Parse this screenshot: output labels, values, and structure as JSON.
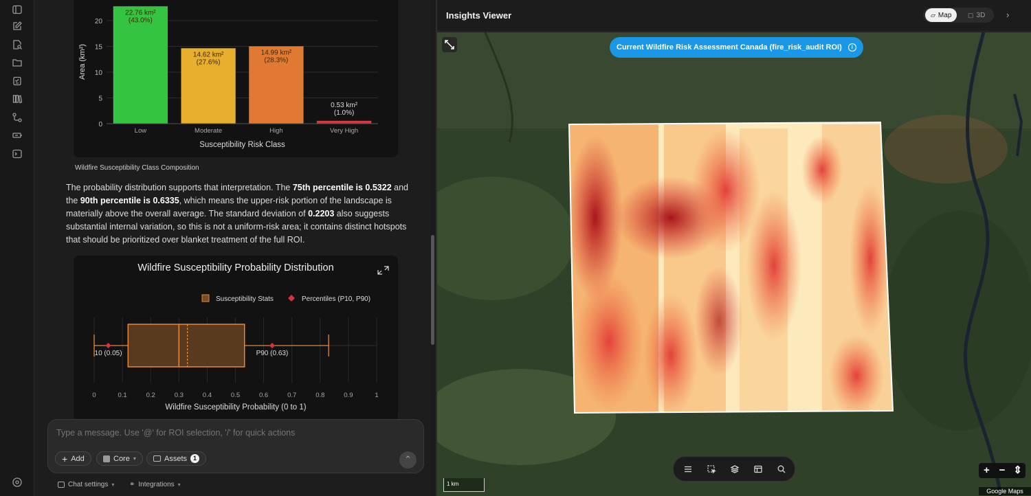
{
  "rail": {
    "icons": [
      "sidebar-toggle-icon",
      "compose-icon",
      "search-doc-icon",
      "folder-icon",
      "checklist-icon",
      "library-icon",
      "workflow-icon",
      "battery-icon",
      "terminal-icon",
      "settings-icon"
    ]
  },
  "bar_chart": {
    "caption": "Wildfire Susceptibility Class Composition",
    "chart_data": {
      "type": "bar",
      "categories": [
        "Low",
        "Moderate",
        "High",
        "Very High"
      ],
      "values": [
        22.76,
        14.62,
        14.99,
        0.53
      ],
      "data_labels": [
        "22.76 km²",
        "14.62 km²",
        "14.99 km²",
        "0.53 km²"
      ],
      "percent_labels": [
        "(43.0%)",
        "(27.6%)",
        "(28.3%)",
        "(1.0%)"
      ],
      "colors": [
        "#35c43f",
        "#e8ae2e",
        "#e07a32",
        "#d9343b"
      ],
      "xlabel": "Susceptibility Risk Class",
      "ylabel": "Area (km²)",
      "yticks": [
        "0",
        "5",
        "10",
        "15",
        "20"
      ],
      "ylim": [
        0,
        24
      ]
    }
  },
  "paragraph": {
    "t1": "The probability distribution supports that interpretation. The ",
    "b1": "75th percentile is 0.5322",
    "t2": " and the ",
    "b2": "90th percentile is 0.6335",
    "t3": ", which means the upper-risk portion of the landscape is materially above the overall average. The standard deviation of ",
    "b3": "0.2203",
    "t4": " also suggests substantial internal variation, so this is not a uniform-risk area; it contains distinct hotspots that should be prioritized over blanket treatment of the full ROI."
  },
  "box_chart": {
    "chart_data": {
      "type": "box",
      "title": "Wildfire Susceptibility Probability Distribution",
      "legend": [
        "Susceptibility Stats",
        "Percentiles (P10, P90)"
      ],
      "min": 0.0,
      "q1": 0.12,
      "median": 0.3,
      "mean": 0.33,
      "q3": 0.5322,
      "max": 0.83,
      "p10": 0.05,
      "p90": 0.63,
      "p10_label": "10 (0.05)",
      "p90_label": "P90 (0.63)",
      "xlabel": "Wildfire Susceptibility Probability (0 to 1)",
      "xticks": [
        "0",
        "0.1",
        "0.2",
        "0.3",
        "0.4",
        "0.5",
        "0.6",
        "0.7",
        "0.8",
        "0.9",
        "1"
      ],
      "xlim": [
        0,
        1
      ]
    }
  },
  "composer": {
    "placeholder": "Type a message. Use '@' for ROI selection, '/' for quick actions",
    "add_label": "Add",
    "core_label": "Core",
    "assets_label": "Assets",
    "assets_count": "1"
  },
  "footer": {
    "chat_settings": "Chat settings",
    "integrations": "Integrations"
  },
  "viewer": {
    "title": "Insights Viewer",
    "map_label": "Map",
    "three_d_label": "3D",
    "roi_label": "Current Wildfire Risk Assessment Canada (fire_risk_audit ROI)",
    "scale": "1 km",
    "zoom_in": "+",
    "zoom_out": "−",
    "attribution": "Google Maps"
  },
  "colors": {
    "accent": "#1b97e8",
    "surface": "#121212"
  }
}
